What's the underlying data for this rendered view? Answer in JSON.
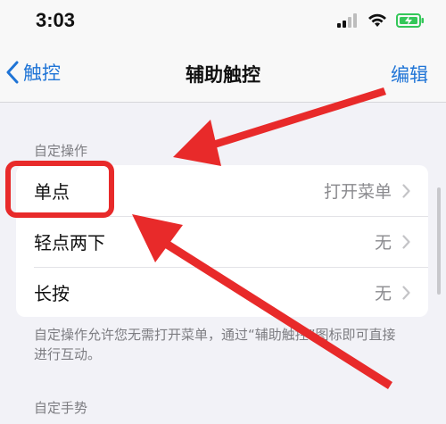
{
  "status_bar": {
    "time": "3:03"
  },
  "nav": {
    "back_label": "触控",
    "title": "辅助触控",
    "edit_label": "编辑"
  },
  "custom_actions": {
    "header": "自定操作",
    "items": [
      {
        "label": "单点",
        "value": "打开菜单"
      },
      {
        "label": "轻点两下",
        "value": "无"
      },
      {
        "label": "长按",
        "value": "无"
      }
    ],
    "footnote": "自定操作允许您无需打开菜单，通过“辅助触控”图标即可直接进行互动。"
  },
  "custom_gestures": {
    "header": "自定手势"
  },
  "colors": {
    "accent": "#1f74d6",
    "annotation": "#e82a2a",
    "battery": "#34c759"
  }
}
